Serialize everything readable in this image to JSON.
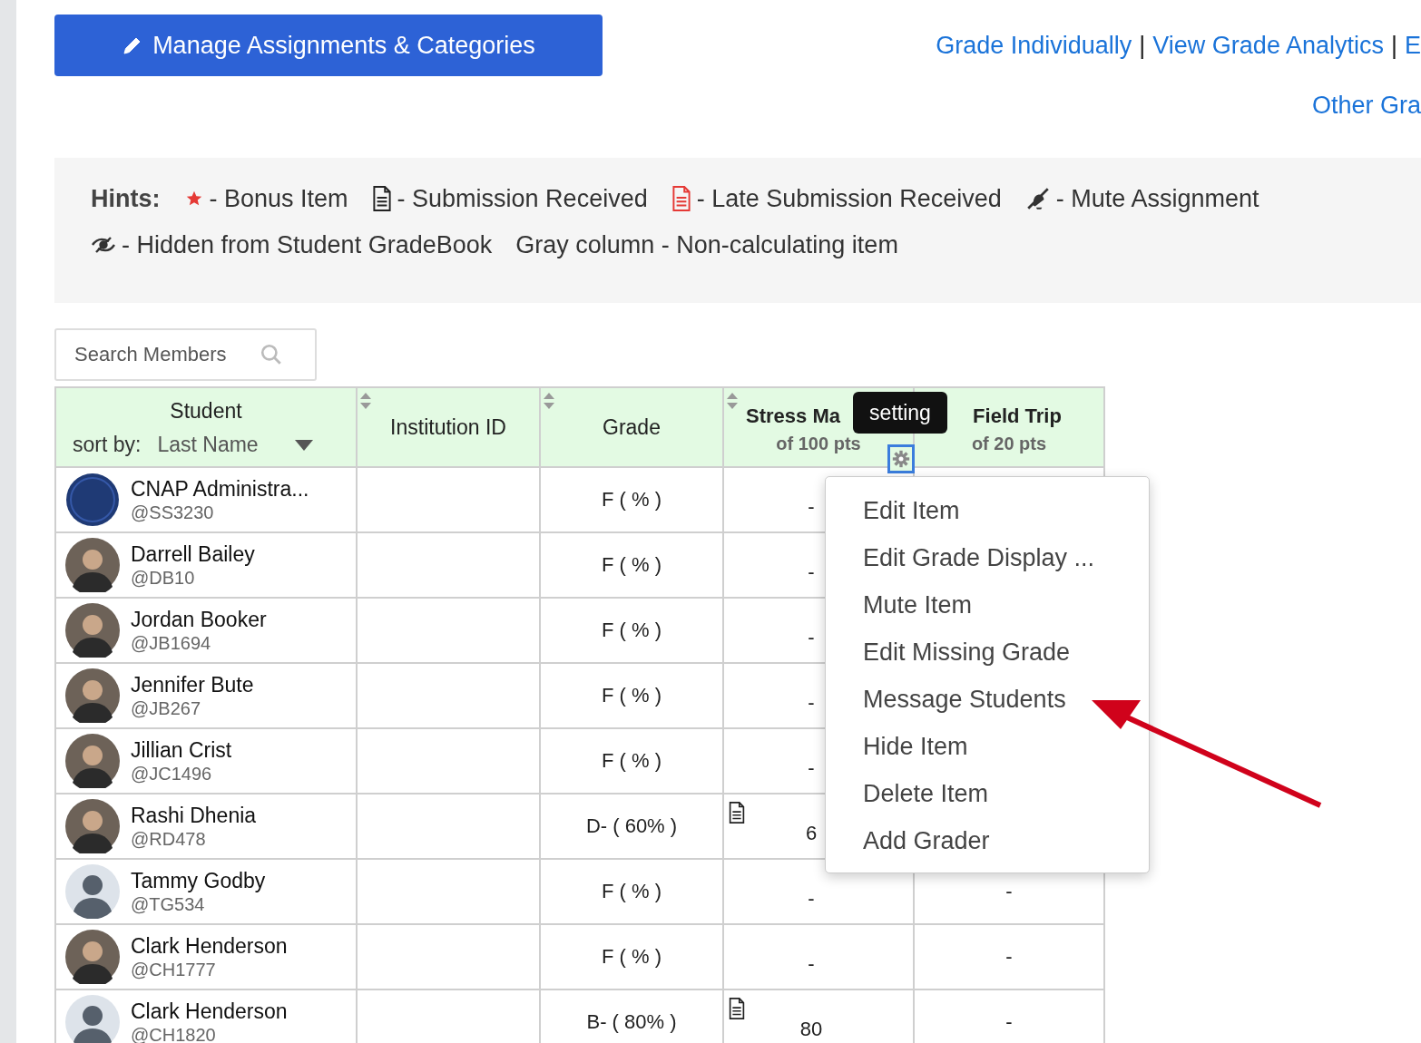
{
  "manage_button": {
    "label": "Manage Assignments & Categories"
  },
  "top_links": [
    {
      "kind": "link",
      "label": "Grade Individually"
    },
    {
      "kind": "separator",
      "label": "|"
    },
    {
      "kind": "link",
      "label": "View Grade Analytics"
    },
    {
      "kind": "separator",
      "label": "|"
    },
    {
      "kind": "link",
      "label": "E"
    }
  ],
  "other_link": {
    "label": "Other Gra"
  },
  "hints": {
    "label": "Hints:",
    "items": [
      {
        "kind": "star",
        "text": "- Bonus Item"
      },
      {
        "kind": "doc",
        "text": "- Submission Received"
      },
      {
        "kind": "late",
        "text": "- Late Submission Received"
      },
      {
        "kind": "mute",
        "text": "- Mute Assignment"
      },
      {
        "kind": "hidden",
        "text": "- Hidden from Student GradeBook"
      },
      {
        "kind": "plain",
        "text": "Gray column - Non-calculating item"
      }
    ]
  },
  "search": {
    "placeholder": "Search Members"
  },
  "table": {
    "student_header": {
      "title": "Student",
      "sort_label": "sort by:",
      "sort_value": "Last Name"
    },
    "columns": [
      {
        "kind": "text",
        "title": "Institution ID",
        "sortable": true
      },
      {
        "kind": "text",
        "title": "Grade",
        "sortable": true
      },
      {
        "kind": "assignment",
        "title": "Stress Ma",
        "points": "of 100 pts",
        "sortable": true
      },
      {
        "kind": "assignment",
        "title": "Field Trip",
        "points": "of 20 pts"
      }
    ],
    "rows": [
      {
        "name": "CNAP Administra...",
        "handle": "@SS3230",
        "avatar": {
          "kind": "logo"
        },
        "grade": "F ( % )",
        "score": "-",
        "submitted": false
      },
      {
        "name": "Darrell Bailey",
        "handle": "@DB10",
        "avatar": {
          "kind": "photo"
        },
        "grade": "F ( % )",
        "score": "-",
        "submitted": false
      },
      {
        "name": "Jordan Booker",
        "handle": "@JB1694",
        "avatar": {
          "kind": "photo"
        },
        "grade": "F ( % )",
        "score": "-",
        "submitted": false
      },
      {
        "name": "Jennifer Bute",
        "handle": "@JB267",
        "avatar": {
          "kind": "photo"
        },
        "grade": "F ( % )",
        "score": "-",
        "submitted": false
      },
      {
        "name": "Jillian Crist",
        "handle": "@JC1496",
        "avatar": {
          "kind": "photo"
        },
        "grade": "F ( % )",
        "score": "-",
        "submitted": false
      },
      {
        "name": "Rashi Dhenia",
        "handle": "@RD478",
        "avatar": {
          "kind": "photo"
        },
        "grade": "D- ( 60% )",
        "score": "6",
        "submitted": true
      },
      {
        "name": "Tammy Godby",
        "handle": "@TG534",
        "avatar": {
          "kind": "default"
        },
        "grade": "F ( % )",
        "score": "-",
        "submitted": false,
        "field_trip": "-"
      },
      {
        "name": "Clark Henderson",
        "handle": "@CH1777",
        "avatar": {
          "kind": "photo"
        },
        "grade": "F ( % )",
        "score": "-",
        "submitted": false,
        "field_trip": "-"
      },
      {
        "name": "Clark Henderson",
        "handle": "@CH1820",
        "avatar": {
          "kind": "default"
        },
        "grade": "B- ( 80% )",
        "score": "80",
        "submitted": true,
        "field_trip": "-"
      }
    ]
  },
  "tooltip": {
    "text": "setting"
  },
  "menu": {
    "items": [
      "Edit Item",
      "Edit Grade Display ...",
      "Mute Item",
      "Edit Missing Grade",
      "Message Students",
      "Hide Item",
      "Delete Item",
      "Add Grader"
    ]
  }
}
